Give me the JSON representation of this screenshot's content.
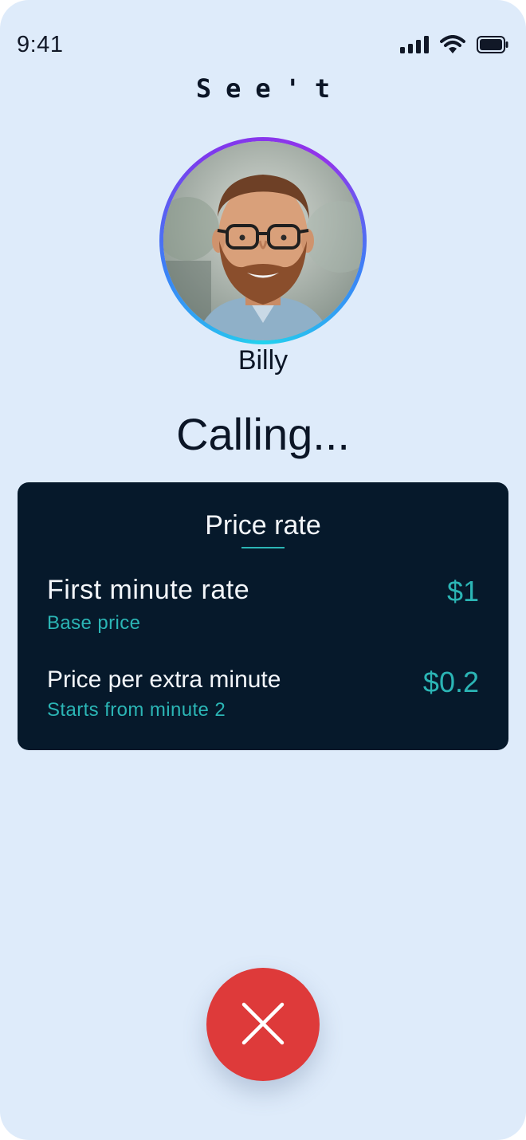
{
  "status_bar": {
    "time": "9:41",
    "icons": [
      "cellular-signal-icon",
      "wifi-icon",
      "battery-icon"
    ]
  },
  "app": {
    "logo_text": "See't"
  },
  "caller": {
    "name": "Billy",
    "avatar": "avatar-photo",
    "call_status": "Calling..."
  },
  "price_card": {
    "title": "Price rate",
    "rates": [
      {
        "label": "First minute rate",
        "sub": "Base price",
        "value": "$1"
      },
      {
        "label": "Price per extra minute",
        "sub": "Starts from minute 2",
        "value": "$0.2"
      }
    ]
  },
  "actions": {
    "end_call_icon": "close-icon"
  },
  "colors": {
    "background": "#deebfa",
    "card": "#06192b",
    "accent_teal": "#2bb5b5",
    "end_call_red": "#de3a3a",
    "ring_gradient": [
      "#22d3ee",
      "#3b82f6",
      "#9333ea"
    ]
  }
}
